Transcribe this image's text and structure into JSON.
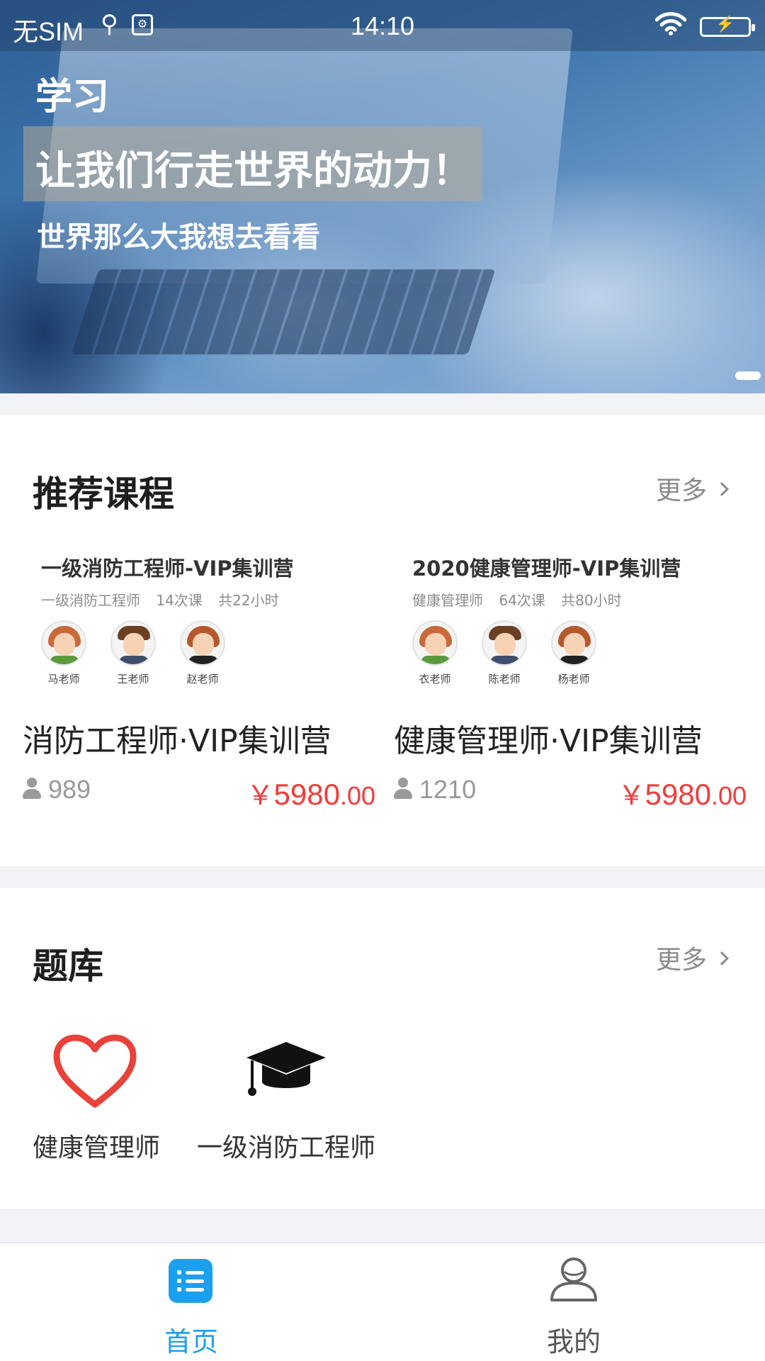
{
  "status_bar": {
    "carrier": "无SIM",
    "time": "14:10"
  },
  "banner": {
    "title": "学习",
    "slogan": "让我们行走世界的动力！",
    "subtitle": "世界那么大我想去看看"
  },
  "recommended": {
    "title": "推荐课程",
    "more": "更多",
    "courses": [
      {
        "thumb_title": "一级消防工程师-VIP集训营",
        "thumb_meta": "一级消防工程师 14次课 共22小时",
        "teachers": [
          "马老师",
          "王老师",
          "赵老师"
        ],
        "name": "消防工程师·VIP集训营",
        "students": "989",
        "price_currency": "￥",
        "price_int": "5980",
        "price_dec": ".00"
      },
      {
        "thumb_title": "2020健康管理师-VIP集训营",
        "thumb_meta": "健康管理师 64次课 共80小时",
        "teachers": [
          "衣老师",
          "陈老师",
          "杨老师"
        ],
        "name": "健康管理师·VIP集训营",
        "students": "1210",
        "price_currency": "￥",
        "price_int": "5980",
        "price_dec": ".00"
      }
    ]
  },
  "question_bank": {
    "title": "题库",
    "more": "更多",
    "items": [
      {
        "label": "健康管理师",
        "icon": "heart-icon"
      },
      {
        "label": "一级消防工程师",
        "icon": "graduation-cap-icon"
      }
    ]
  },
  "tabbar": {
    "tabs": [
      {
        "label": "首页",
        "icon": "list-icon",
        "active": true
      },
      {
        "label": "我的",
        "icon": "user-icon",
        "active": false
      }
    ]
  },
  "colors": {
    "accent": "#1aa0ee",
    "price": "#f23b3b",
    "muted": "#999999"
  }
}
